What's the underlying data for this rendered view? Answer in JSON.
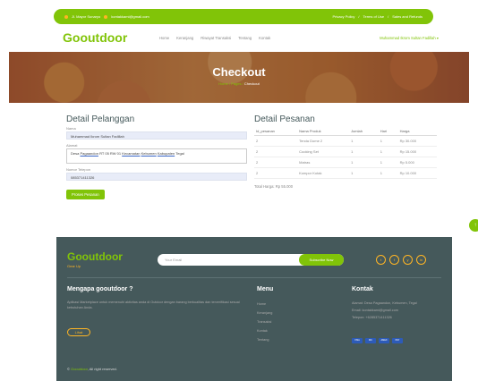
{
  "topbar": {
    "left_items": [
      "Jl. Mayor Sunaryo",
      "kontakkami@gmail.com"
    ],
    "right_items": [
      "Privacy Policy",
      "Terms of Use",
      "Sales and Refunds"
    ]
  },
  "navbar": {
    "brand": "Gooutdoor",
    "menu": [
      "Home",
      "Keranjang",
      "Riwayat Transaksi",
      "Tentang",
      "Kontak"
    ],
    "user": "Muhammad Ikrom Sultan Fadillah"
  },
  "hero": {
    "title": "Checkout",
    "crumbs": [
      "Home",
      "Pages",
      "Checkout"
    ]
  },
  "customer": {
    "title": "Detail Pelanggan",
    "name_label": "Nama",
    "name_value": "Muhammad Ikrom Sultan Fadillah",
    "address_label": "Alamat",
    "address_value": [
      "Desa",
      "Pagaandon",
      "RT 05 RW 01",
      "Kecamatan",
      "Kebumen",
      "Kabupaten",
      "Tegal"
    ],
    "phone_label": "Nomor Telepon",
    "phone_value": "085371411326",
    "submit": "Proses Pesanan"
  },
  "order": {
    "title": "Detail Pesanan",
    "columns": [
      "Id_pesanan",
      "Nama Produk",
      "Jumlah",
      "Hari",
      "Harga"
    ],
    "rows": [
      [
        "2",
        "Tenda Dome 2",
        "1",
        "1",
        "Rp 30.000"
      ],
      [
        "2",
        "Cooking Set",
        "1",
        "1",
        "Rp 15.000"
      ],
      [
        "2",
        "Matras",
        "1",
        "1",
        "Rp 5.000"
      ],
      [
        "2",
        "Kompor Kotak",
        "1",
        "1",
        "Rp 10.000"
      ]
    ],
    "total": "Total Harga: Rp 55.000"
  },
  "footer": {
    "brand": "Gooutdoor",
    "tagline": "Gear Up",
    "email_placeholder": "Your Email",
    "subscribe": "Subscribe Now",
    "socials": [
      "t",
      "f",
      "y",
      "in"
    ],
    "about_title": "Mengapa gooutdoor ?",
    "about_text": "Aplikasi Marketplace untuk memenuhi aktivitas anda di Outdoor dengan barang berkualitas dan terverifikasi sesuai kebutuhan Anda.",
    "read_more": "Lihat",
    "menu_title": "Menu",
    "menu_links": [
      "Home",
      "Keranjang",
      "Transaksi",
      "Kontak",
      "Tentang"
    ],
    "contact_title": "Kontak",
    "contact_lines": [
      "Alamat: Desa Pagaandon, Kebumen, Tegal",
      "Email: kontakkami@gmail.com",
      "Telepon: +6285371411326"
    ],
    "payments": [
      "VISA",
      "MC",
      "AMEX",
      "PAY"
    ],
    "copyright_brand": "Gooutdoor",
    "copyright_text": ", All right reserved."
  },
  "colors": {
    "accent": "#81c408",
    "secondary": "#ffb524",
    "footer_bg": "#45595b"
  }
}
